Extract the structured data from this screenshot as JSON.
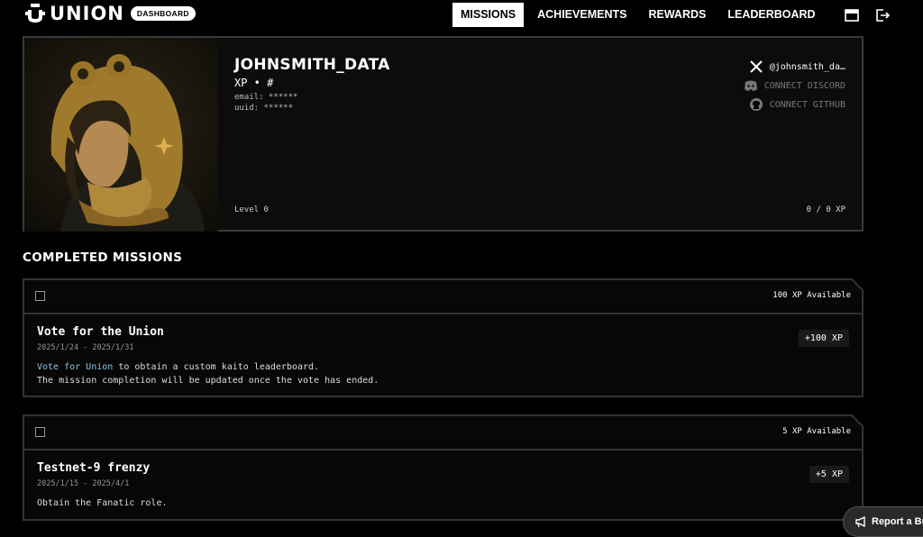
{
  "header": {
    "logo_text": "UNION",
    "badge": "DASHBOARD",
    "nav": [
      "MISSIONS",
      "ACHIEVEMENTS",
      "REWARDS",
      "LEADERBOARD"
    ]
  },
  "profile": {
    "username": "JOHNSMITH_DATA",
    "xp_line": "XP • #",
    "email": "email: ******",
    "uuid": "uuid:  ******",
    "level": "Level 0",
    "xp": "0 / 0 XP",
    "socials": {
      "twitter": "@johnsmith_da…",
      "discord": "CONNECT DISCORD",
      "github": "CONNECT GITHUB"
    }
  },
  "section_title": "COMPLETED MISSIONS",
  "missions": [
    {
      "available": "100 XP Available",
      "title": "Vote for the Union",
      "date": "2025/1/24 - 2025/1/31",
      "desc_link": "Vote for Union",
      "desc_rest": " to obtain a custom kaito leaderboard.",
      "desc_line2": "The mission completion will be updated once the vote has ended.",
      "xp_badge": "+100 XP"
    },
    {
      "available": "5 XP Available",
      "title": "Testnet-9 frenzy",
      "date": "2025/1/15 - 2025/4/1",
      "desc_line1": "Obtain the Fanatic role.",
      "xp_badge": "+5 XP"
    }
  ],
  "report_button": "Report a Bu"
}
